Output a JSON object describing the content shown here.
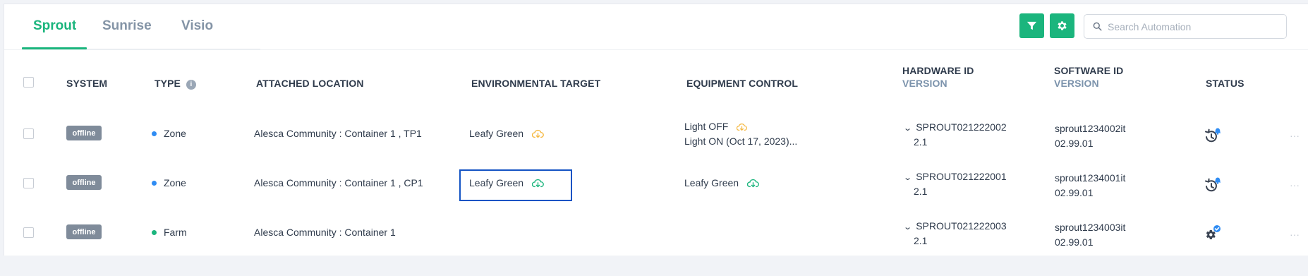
{
  "tabs": [
    {
      "label": "Sprout",
      "active": true
    },
    {
      "label": "Sunrise",
      "active": false
    },
    {
      "label": "Visio",
      "active": false
    }
  ],
  "toolbar": {
    "filter_icon": "filter-icon",
    "settings_icon": "gear-icon",
    "search_placeholder": "Search Automation",
    "accent_color": "#1bb57d"
  },
  "table": {
    "headers": {
      "system": "SYSTEM",
      "type": "TYPE",
      "attached_location": "ATTACHED LOCATION",
      "environmental_target": "ENVIRONMENTAL TARGET",
      "equipment_control": "EQUIPMENT CONTROL",
      "hardware_id": "HARDWARE ID",
      "hardware_version": "VERSION",
      "software_id": "SOFTWARE ID",
      "software_version": "VERSION",
      "status": "STATUS"
    },
    "rows": [
      {
        "system": "offline",
        "type": "Zone",
        "type_color": "#2f8cf3",
        "location": "Alesca Community : Container 1 , TP1",
        "env_target": "Leafy Green",
        "env_cloud_color": "#f5b841",
        "equip_line1": "Light OFF",
        "equip_line1_cloud_color": "#f5b841",
        "equip_line2": "Light ON (Oct 17, 2023)...",
        "hardware_id": "SPROUT021222002",
        "hardware_version": "2.1",
        "software_id": "sprout1234002it",
        "software_version": "02.99.01",
        "status_icon": "history-bell-icon",
        "more": "···"
      },
      {
        "system": "offline",
        "type": "Zone",
        "type_color": "#2f8cf3",
        "location": "Alesca Community : Container 1 , CP1",
        "env_target": "Leafy Green",
        "env_cloud_color": "#1bb57d",
        "equip_line1": "Leafy Green",
        "equip_line1_cloud_color": "#1bb57d",
        "equip_line2": "",
        "hardware_id": "SPROUT021222001",
        "hardware_version": "2.1",
        "software_id": "sprout1234001it",
        "software_version": "02.99.01",
        "status_icon": "history-bell-icon",
        "more": "···"
      },
      {
        "system": "offline",
        "type": "Farm",
        "type_color": "#1bb57d",
        "location": "Alesca Community : Container 1",
        "env_target": "",
        "equip_line1": "",
        "equip_line2": "",
        "hardware_id": "SPROUT021222003",
        "hardware_version": "2.1",
        "software_id": "sprout1234003it",
        "software_version": "02.99.01",
        "status_icon": "gear-check-icon",
        "more": "···"
      }
    ]
  }
}
